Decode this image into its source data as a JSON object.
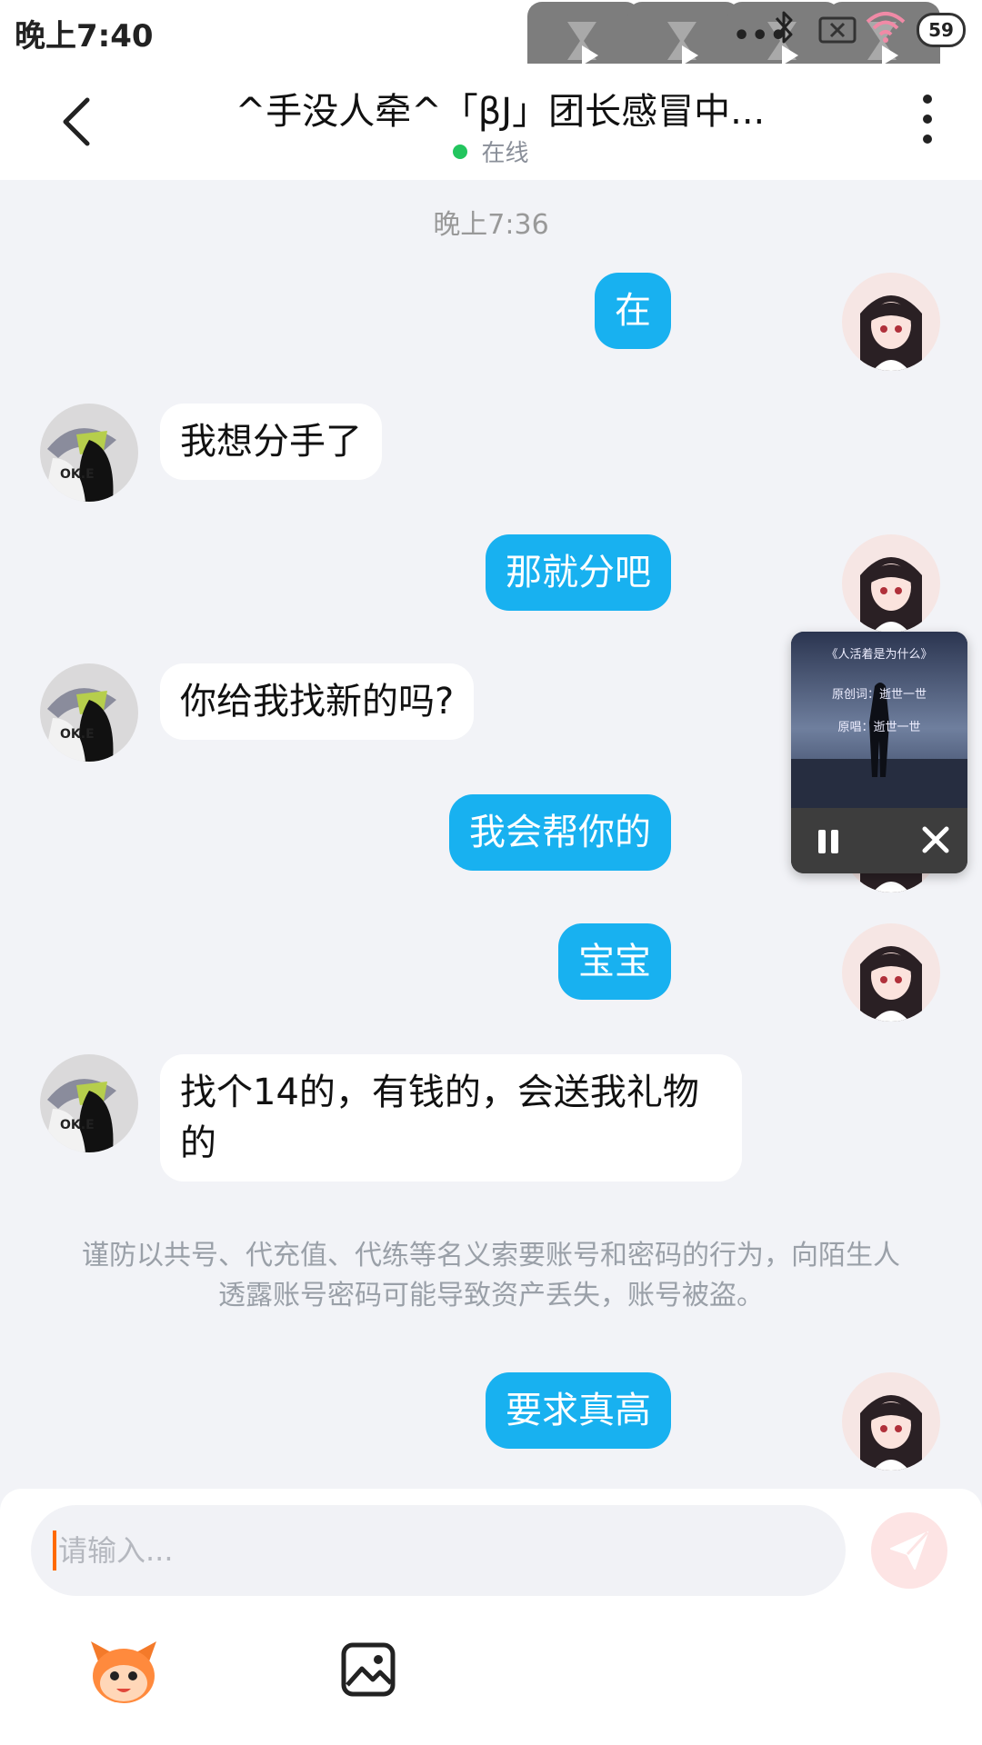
{
  "status_bar": {
    "time": "晚上7:40",
    "overflow_dots": "•••",
    "battery": "59"
  },
  "header": {
    "title": "^手没人牵^「βJ」团长感冒中...",
    "presence": "在线"
  },
  "chat": {
    "timestamp": "晚上7:36",
    "messages": [
      {
        "side": "out",
        "text": "在"
      },
      {
        "side": "in",
        "text": "我想分手了"
      },
      {
        "side": "out",
        "text": "那就分吧"
      },
      {
        "side": "in",
        "text": "你给我找新的吗?"
      },
      {
        "side": "out",
        "text": "我会帮你的"
      },
      {
        "side": "out",
        "text": "宝宝"
      },
      {
        "side": "in",
        "text": "找个14的，有钱的，会送我礼物的"
      },
      {
        "side": "out",
        "text": "要求真高"
      }
    ],
    "notice": "谨防以共号、代充值、代练等名义索要账号和密码的行为，向陌生人透露账号密码可能导致资产丢失，账号被盗。"
  },
  "mini_player": {
    "cover_title": "《人活着是为什么》",
    "cover_line_1": "原创词：逝世一世",
    "cover_line_2": "原唱：逝世一世"
  },
  "input": {
    "placeholder": "请输入..."
  },
  "colors": {
    "outgoing_bubble": "#18b1f0",
    "incoming_bubble": "#ffffff",
    "background": "#f2f3f7",
    "online_dot": "#22c55e"
  },
  "icons": [
    "back-arrow-icon",
    "more-vertical-icon",
    "send-icon",
    "emoji-mascot-icon",
    "image-icon",
    "pause-icon",
    "close-icon"
  ]
}
